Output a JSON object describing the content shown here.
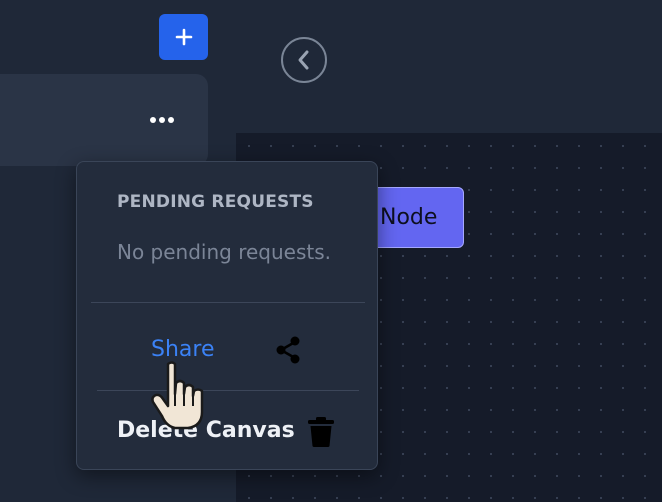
{
  "sidebar": {
    "add_button_label": "+",
    "canvas_item_menu_icon": "more-horizontal-icon"
  },
  "topbar": {
    "back_icon": "chevron-left-icon"
  },
  "canvas": {
    "node_label": "Node"
  },
  "menu": {
    "heading": "PENDING REQUESTS",
    "empty_text": "No pending requests.",
    "share_label": "Share",
    "share_icon": "share-icon",
    "delete_label": "Delete Canvas",
    "delete_icon": "trash-icon"
  },
  "colors": {
    "accent": "#2563eb",
    "link": "#3b82f6",
    "node": "#6366f1"
  }
}
